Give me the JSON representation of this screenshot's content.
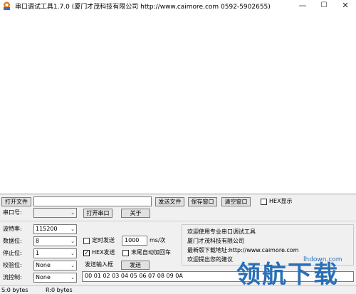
{
  "window": {
    "title": "串口调试工具1.7.0  (厦门才茂科技有限公司 http://www.caimore.com 0592-5902655)",
    "minimize": "—",
    "maximize": "☐",
    "close": "✕"
  },
  "toolbar": {
    "open_file": "打开文件",
    "file_path": "",
    "send_file": "发送文件",
    "save_window": "保存窗口",
    "clear_window": "清空窗口",
    "hex_display": "HEX显示"
  },
  "port": {
    "label": "串口号:",
    "value": "",
    "open_button": "打开串口",
    "close_button": "关于"
  },
  "settings": {
    "baud_label": "波特率:",
    "baud_value": "115200",
    "data_label": "数据位:",
    "data_value": "8",
    "stop_label": "停止位:",
    "stop_value": "1",
    "parity_label": "校验位:",
    "parity_value": "None",
    "flow_label": "流控制:",
    "flow_value": "None"
  },
  "send": {
    "timed_send": "定时发送",
    "interval": "1000",
    "unit": "ms/次",
    "hex_send": "HEX发送",
    "hex_send_checked": true,
    "auto_newline": "末尾自动加回车",
    "input_label": "发送输入框",
    "send_button": "发送",
    "content": "00 01 02 03 04 05 06 07 08 09 0A"
  },
  "info": {
    "line1": "欢迎使用专业串口调试工具",
    "line2": "厦门才茂科技有限公司",
    "line3": "最新版下载地址:http://www.caimore.com",
    "line4": "欢迎提出您的建议"
  },
  "status": {
    "sent": "S:0 bytes",
    "received": "R:0 bytes"
  },
  "watermark": {
    "brand": "领航下载",
    "domain": "lhdown.com"
  }
}
